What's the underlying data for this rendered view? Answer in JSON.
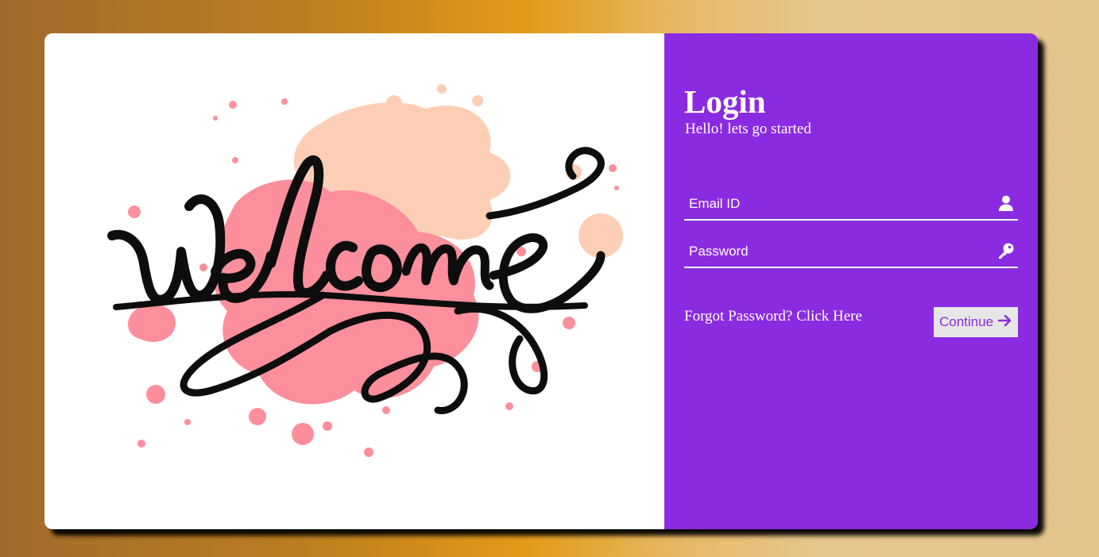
{
  "colors": {
    "panel_purple": "#8a2be2",
    "panel_white": "#ffffff",
    "button_bg": "#e6e6e6",
    "splash_peach": "#fdceb6",
    "splash_pink": "#fc8f9b",
    "ink": "#0d0d0d"
  },
  "hero": {
    "image_text": "Welcome"
  },
  "login": {
    "title": "Login",
    "subtitle": "Hello! lets go started",
    "email": {
      "placeholder": "Email ID",
      "value": "",
      "icon": "user-icon"
    },
    "password": {
      "placeholder": "Password",
      "value": "",
      "icon": "key-icon"
    },
    "forgot_text": "Forgot Password? Click Here",
    "continue_label": "Continue",
    "continue_icon": "arrow-right-icon"
  }
}
